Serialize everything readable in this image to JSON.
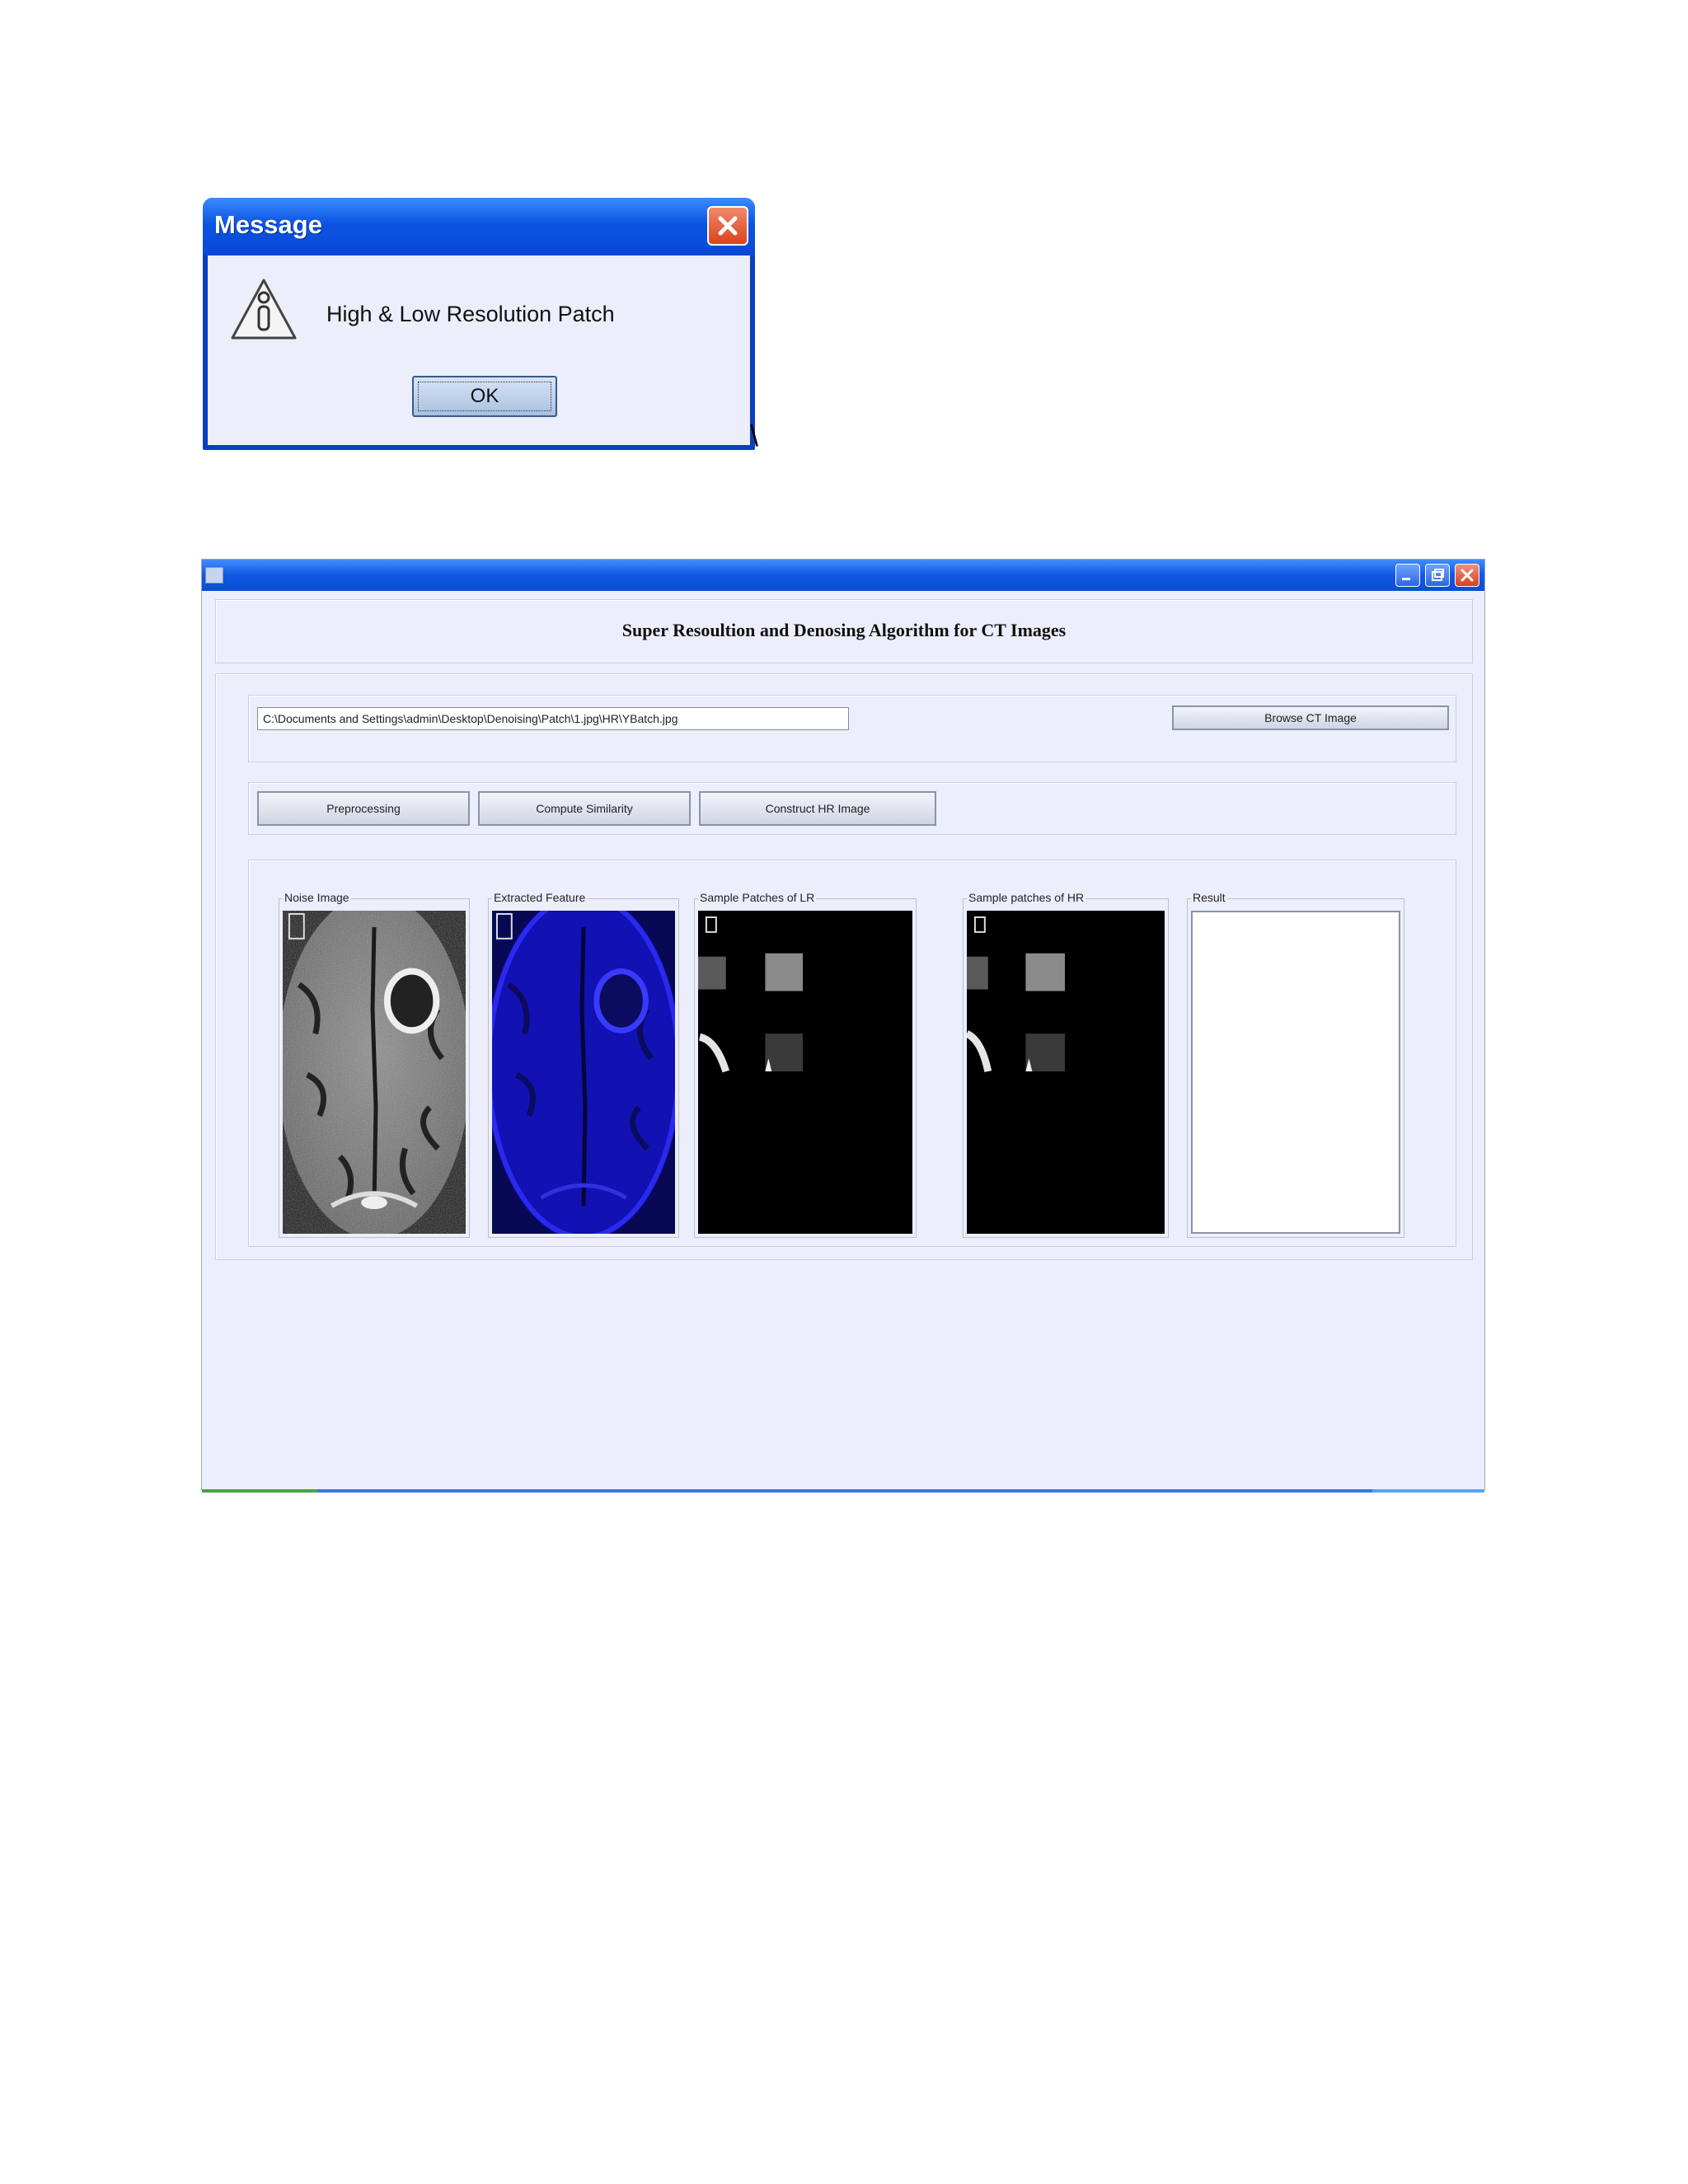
{
  "dialog": {
    "title": "Message",
    "message": "High & Low Resolution Patch",
    "ok_label": "OK"
  },
  "stray_text": "\\",
  "window": {
    "heading": "Super Resoultion and Denosing Algorithm for CT Images",
    "file_path": "C:\\Documents and Settings\\admin\\Desktop\\Denoising\\Patch\\1.jpg\\HR\\YBatch.jpg",
    "browse_label": "Browse CT Image",
    "buttons": {
      "preprocessing": "Preprocessing",
      "compute_similarity": "Compute Similarity",
      "construct_hr": "Construct HR Image"
    },
    "groups": {
      "noise": "Noise Image",
      "extracted": "Extracted Feature",
      "lr": "Sample Patches of LR",
      "hr": "Sample patches of HR",
      "result": "Result"
    }
  },
  "colors": {
    "titlebar_blue": "#0c54e3",
    "window_bg": "#eceffb",
    "close_red": "#d9441c",
    "feature_blue": "#1a1acc"
  },
  "icons": [
    "close-icon",
    "warning-icon",
    "app-icon",
    "minimize-icon",
    "maximize-icon"
  ]
}
